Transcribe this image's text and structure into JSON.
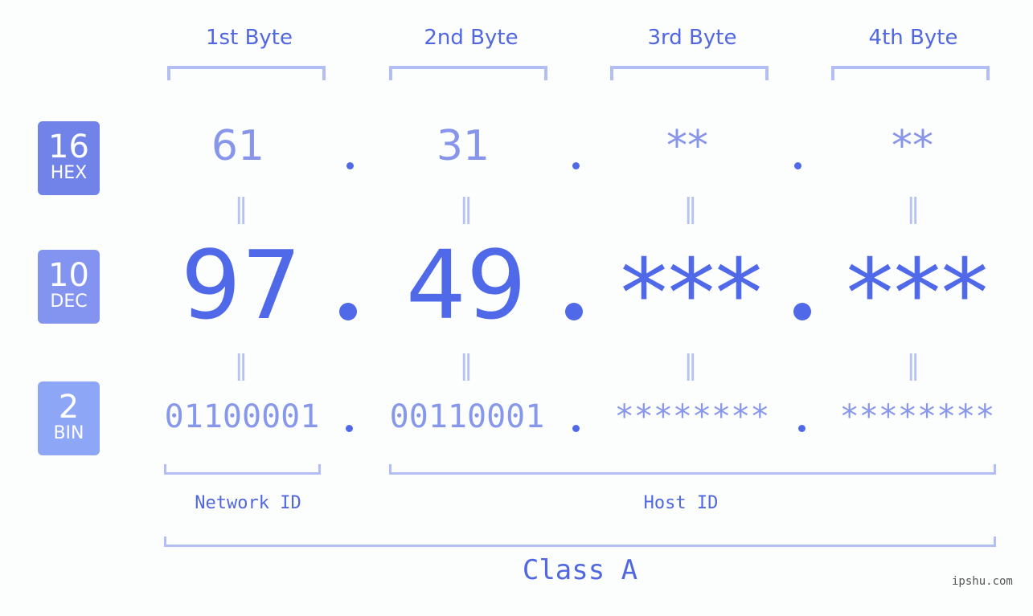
{
  "badges": [
    {
      "num": "16",
      "label": "HEX"
    },
    {
      "num": "10",
      "label": "DEC"
    },
    {
      "num": "2",
      "label": "BIN"
    }
  ],
  "byte_headers": [
    "1st Byte",
    "2nd Byte",
    "3rd Byte",
    "4th Byte"
  ],
  "hex": [
    "61",
    "31",
    "**",
    "**"
  ],
  "dec": [
    "97",
    "49",
    "***",
    "***"
  ],
  "bin": [
    "01100001",
    "00110001",
    "********",
    "********"
  ],
  "equals_sign": "=",
  "separator": ".",
  "network_id_label": "Network ID",
  "host_id_label": "Host ID",
  "class_label": "Class A",
  "watermark": "ipshu.com",
  "colors": {
    "hex_badge": "#7182e8",
    "dec_badge": "#8393f0",
    "bin_badge": "#8ea6f6",
    "accent": "#5069e8",
    "bracket": "#b3bff4"
  }
}
